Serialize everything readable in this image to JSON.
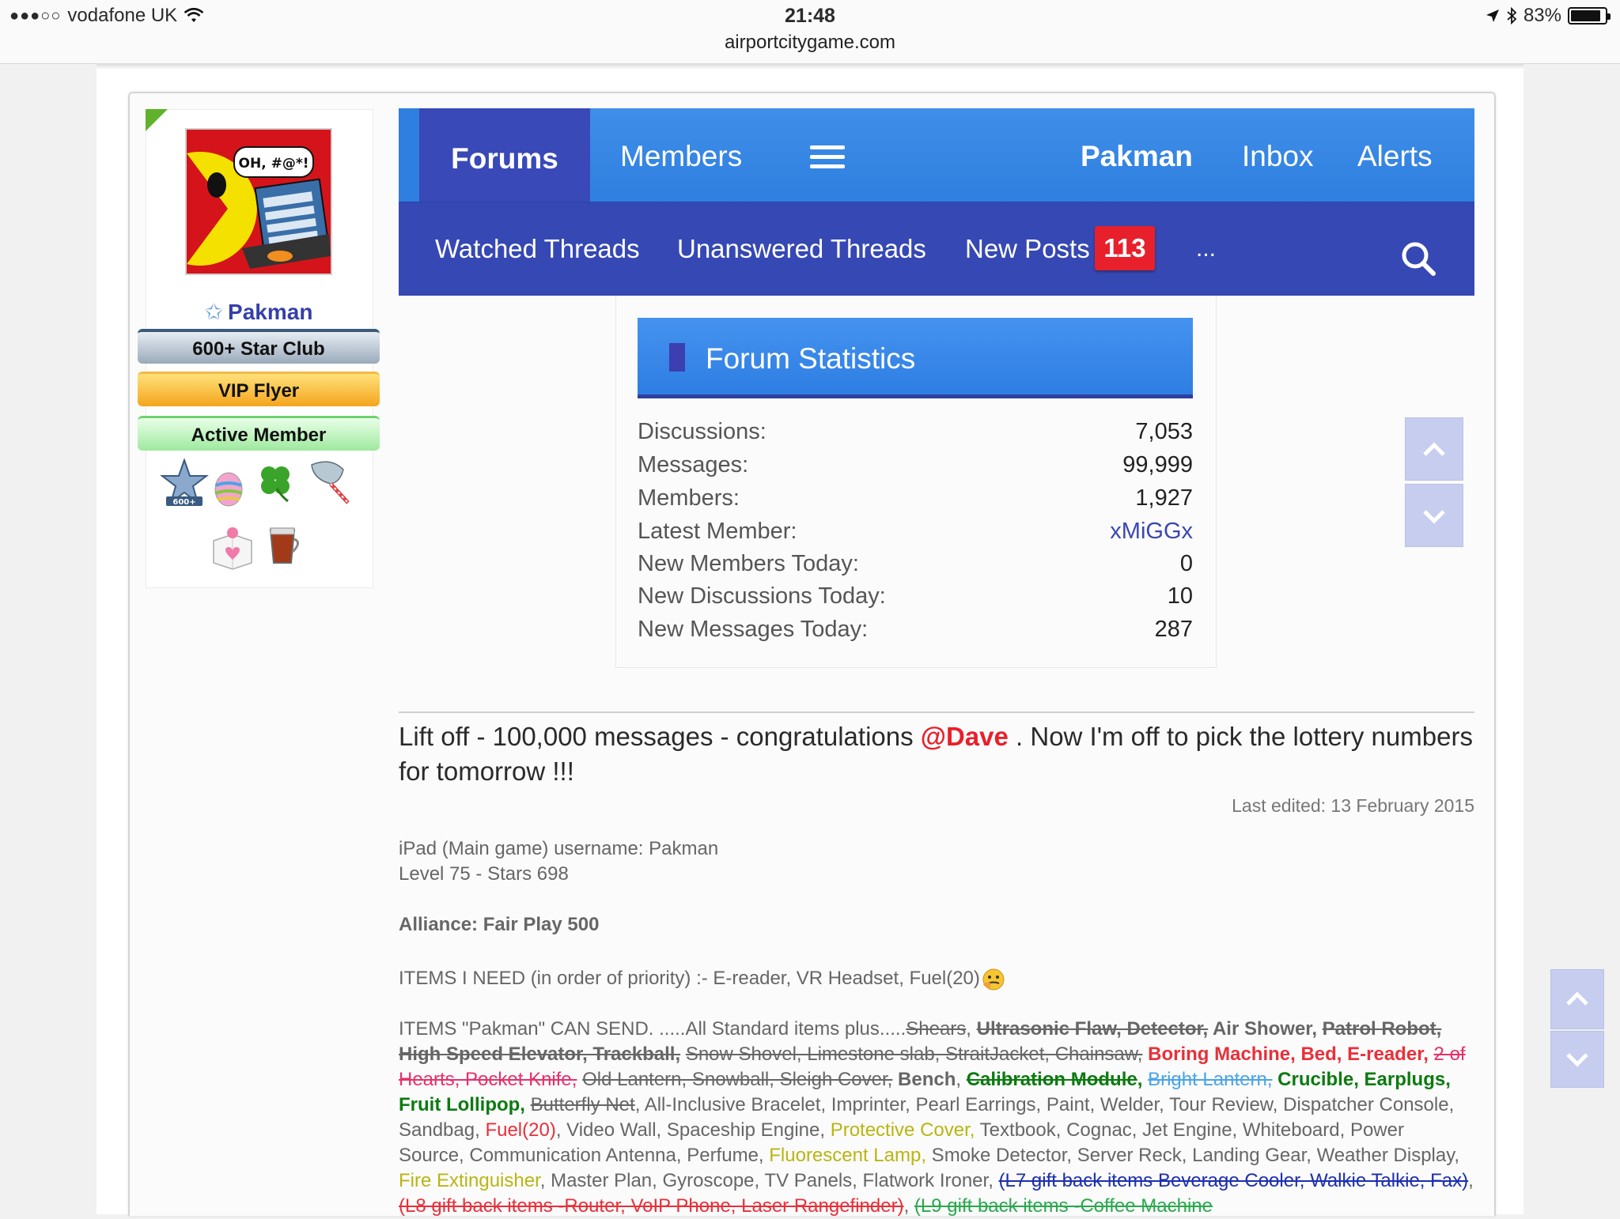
{
  "status_bar": {
    "carrier": "vodafone UK",
    "time": "21:48",
    "url": "airportcitygame.com",
    "battery": "83%"
  },
  "user_panel": {
    "username": "Pakman",
    "badges": [
      "600+ Star Club",
      "VIP Flyer",
      "Active Member"
    ],
    "trophy_icons": [
      "600-star-trophy-icon",
      "easter-egg-icon",
      "four-leaf-clover-icon",
      "fan-icon",
      "gift-box-icon",
      "hot-drink-icon"
    ],
    "colors": {
      "star_club": "#9aaabb",
      "vip": "#f4a51c",
      "active": "#9ee99e"
    }
  },
  "nav": {
    "forums": "Forums",
    "members": "Members",
    "user": "Pakman",
    "inbox": "Inbox",
    "alerts": "Alerts"
  },
  "subnav": {
    "watched": "Watched Threads",
    "unanswered": "Unanswered Threads",
    "new_posts": "New Posts",
    "new_posts_count": "113",
    "more": "..."
  },
  "stats": {
    "title": "Forum Statistics",
    "rows": [
      {
        "label": "Discussions:",
        "value": "7,053"
      },
      {
        "label": "Messages:",
        "value": "99,999"
      },
      {
        "label": "Members:",
        "value": "1,927"
      },
      {
        "label": "Latest Member:",
        "value": "xMiGGx"
      },
      {
        "label": "New Members Today:",
        "value": "0"
      },
      {
        "label": "New Discussions Today:",
        "value": "10"
      },
      {
        "label": "New Messages Today:",
        "value": "287"
      }
    ]
  },
  "post": {
    "line_a": "Lift off - 100,000 messages - congratulations ",
    "mention": "@Dave",
    "line_b": " . Now I'm off to pick the lottery numbers for tomorrow !!!",
    "last_edited": "Last edited: 13 February 2015"
  },
  "signature": {
    "line1": "iPad (Main game) username: Pakman",
    "line2": "Level 75 - Stars 698",
    "alliance": "Alliance: Fair Play 500",
    "need": "ITEMS I NEED (in order of priority) :- E-reader, VR Headset, Fuel(20)",
    "items": [
      {
        "t": "ITEMS \"Pakman\" CAN SEND. .....All Standard items plus.....",
        "c": ""
      },
      {
        "t": "Shears",
        "c": "s"
      },
      {
        "t": ", ",
        "c": ""
      },
      {
        "t": "Ultrasonic Flaw, Detector,",
        "c": "s bo"
      },
      {
        "t": " Air Shower, ",
        "c": "bo"
      },
      {
        "t": "Patrol Robot, High Speed Elevator, Trackball,",
        "c": "s bo"
      },
      {
        "t": " ",
        "c": ""
      },
      {
        "t": "Snow Shovel, Limestone slab, StraitJacket, Chainsaw,",
        "c": "s"
      },
      {
        "t": " Boring Machine, Bed, E-reader, ",
        "c": "bo c-red"
      },
      {
        "t": "2 of Hearts, Pocket Knife,",
        "c": "s c-pink"
      },
      {
        "t": " ",
        "c": ""
      },
      {
        "t": "Old Lantern, Snowball, Sleigh Cover,",
        "c": "s"
      },
      {
        "t": " ",
        "c": ""
      },
      {
        "t": "Bench",
        "c": "bo"
      },
      {
        "t": ", ",
        "c": ""
      },
      {
        "t": "Calibration Module",
        "c": "s bo c-green"
      },
      {
        "t": ", ",
        "c": "bo c-green"
      },
      {
        "t": "Bright Lantern,",
        "c": "s c-lblue"
      },
      {
        "t": " Crucible, Earplugs, Fruit Lollipop, ",
        "c": "bo c-green"
      },
      {
        "t": "Butterfly Net",
        "c": "s"
      },
      {
        "t": ", All-Inclusive Bracelet, Imprinter, Pearl Earrings, Paint, Welder, Tour Review, Dispatcher Console, Sandbag, ",
        "c": ""
      },
      {
        "t": "Fuel(20)",
        "c": "c-red"
      },
      {
        "t": ", Video Wall, Spaceship Engine, ",
        "c": ""
      },
      {
        "t": "Protective Cover,",
        "c": "c-yellow"
      },
      {
        "t": " Textbook, Cognac, Jet Engine, Whiteboard, Power Source, Communication Antenna, Perfume, ",
        "c": ""
      },
      {
        "t": "Fluorescent Lamp,",
        "c": "c-yellow"
      },
      {
        "t": " Smoke Detector, Server Reck, Landing Gear, Weather Display, ",
        "c": ""
      },
      {
        "t": "Fire Extinguisher",
        "c": "c-yellow"
      },
      {
        "t": ", Master Plan, Gyroscope, TV Panels, Flatwork Ironer, ",
        "c": ""
      },
      {
        "t": "(L7 gift back items Beverage Cooler, Walkie Talkie, Fax)",
        "c": "s c-blue"
      },
      {
        "t": ", ",
        "c": ""
      },
      {
        "t": "(L8 gift back items -Router, VoIP Phone, Laser Rangefinder)",
        "c": "s c-red"
      },
      {
        "t": ", ",
        "c": ""
      },
      {
        "t": "(L9 gift back items -Coffee Machine",
        "c": "s c-sgreen"
      }
    ]
  },
  "colors": {
    "nav_blue": "#3f8ee8",
    "nav_dark": "#3648b3",
    "badge_red": "#e8202b",
    "link": "#3a48b0"
  }
}
